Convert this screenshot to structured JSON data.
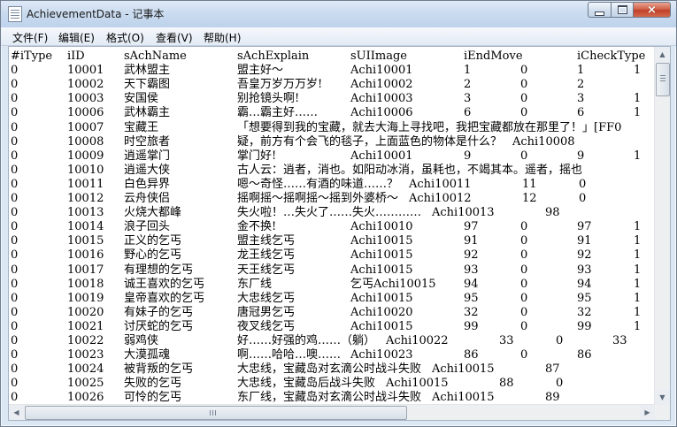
{
  "window": {
    "title": "AchievementData - 记事本",
    "buttons": {
      "minimize": "minimize",
      "maximize": "maximize",
      "close": "×"
    }
  },
  "menu": [
    "文件(F)",
    "编辑(E)",
    "格式(O)",
    "查看(V)",
    "帮助(H)"
  ],
  "header": [
    "#iType",
    "iID",
    "sAchName",
    "sAchExplain",
    "sUIImage",
    "iEndMove",
    "iCheckType"
  ],
  "rows": [
    {
      "type": "0",
      "id": "10001",
      "name": "武林盟主",
      "explain": "盟主好～",
      "image": "Achi10001",
      "c1": "1",
      "c2": "0",
      "c3": "1",
      "c4": "1"
    },
    {
      "type": "0",
      "id": "10002",
      "name": "天下霸图",
      "explain": "吾皇万岁万万岁!",
      "image": "Achi10002",
      "c1": "2",
      "c2": "0",
      "c3": "2",
      "c4": ""
    },
    {
      "type": "0",
      "id": "10003",
      "name": "安国侯",
      "explain": "别抢镜头啊!",
      "image": "Achi10003",
      "c1": "3",
      "c2": "0",
      "c3": "3",
      "c4": "1"
    },
    {
      "type": "0",
      "id": "10006",
      "name": "武林霸主",
      "explain": "霸…霸主好……",
      "image": "Achi10006",
      "c1": "6",
      "c2": "0",
      "c3": "6",
      "c4": "1"
    },
    {
      "type": "0",
      "id": "10007",
      "name": "宝藏王",
      "explain": "「想要得到我的宝藏，就去大海上寻找吧，我把宝藏都放在那里了！」[FF0",
      "image": "",
      "c1": "",
      "c2": "",
      "c3": "",
      "c4": ""
    },
    {
      "type": "0",
      "id": "10008",
      "name": "时空旅者",
      "explain": "疑，前方有个会飞的毯子，上面蓝色的物体是什么？",
      "image": "Achi10008",
      "c1": "",
      "c2": "",
      "c3": "",
      "c4": ""
    },
    {
      "type": "0",
      "id": "10009",
      "name": "逍遥掌门",
      "explain": "掌门好!",
      "image": "Achi10001",
      "c1": "9",
      "c2": "0",
      "c3": "9",
      "c4": "1"
    },
    {
      "type": "0",
      "id": "10010",
      "name": "逍遥大侠",
      "explain": "古人云：逍者，消也。如阳动冰消，虽耗也，不竭其本。遥者，摇也",
      "image": "",
      "c1": "",
      "c2": "",
      "c3": "",
      "c4": ""
    },
    {
      "type": "0",
      "id": "10011",
      "name": "白色异界",
      "explain": "嗯～奇怪……有酒的味道……？",
      "image": "Achi10011",
      "c1": "11",
      "c2": "0",
      "c3": "",
      "c4": ""
    },
    {
      "type": "0",
      "id": "10012",
      "name": "云舟侠侣",
      "explain": "摇啊摇～摇啊摇～摇到外婆桥～",
      "image": "Achi10012",
      "c1": "12",
      "c2": "0",
      "c3": "",
      "c4": ""
    },
    {
      "type": "0",
      "id": "10013",
      "name": "火烧大都峰",
      "explain": "失火啦！…失火了……失火…………",
      "image": "Achi10013",
      "c1": "98",
      "c2": "",
      "c3": "",
      "c4": ""
    },
    {
      "type": "0",
      "id": "10014",
      "name": "浪子回头",
      "explain": "金不换!",
      "image": "Achi10010",
      "c1": "97",
      "c2": "0",
      "c3": "97",
      "c4": "1"
    },
    {
      "type": "0",
      "id": "10015",
      "name": "正义的乞丐",
      "explain": "盟主线乞丐",
      "image": "Achi10015",
      "c1": "91",
      "c2": "0",
      "c3": "91",
      "c4": "1"
    },
    {
      "type": "0",
      "id": "10016",
      "name": "野心的乞丐",
      "explain": "龙王线乞丐",
      "image": "Achi10015",
      "c1": "92",
      "c2": "0",
      "c3": "92",
      "c4": "1"
    },
    {
      "type": "0",
      "id": "10017",
      "name": "有理想的乞丐",
      "explain": "天王线乞丐",
      "image": "Achi10015",
      "c1": "93",
      "c2": "0",
      "c3": "93",
      "c4": "1"
    },
    {
      "type": "0",
      "id": "10018",
      "name": "诚王喜欢的乞丐",
      "explain": "东厂线",
      "image": "乞丐Achi10015",
      "c1": "94",
      "c2": "0",
      "c3": "94",
      "c4": "1"
    },
    {
      "type": "0",
      "id": "10019",
      "name": "皇帝喜欢的乞丐",
      "explain": "大忠线乞丐",
      "image": "Achi10015",
      "c1": "95",
      "c2": "0",
      "c3": "95",
      "c4": "1"
    },
    {
      "type": "0",
      "id": "10020",
      "name": "有妹子的乞丐",
      "explain": "唐冠男乞丐",
      "image": "Achi10020",
      "c1": "32",
      "c2": "0",
      "c3": "32",
      "c4": "1"
    },
    {
      "type": "0",
      "id": "10021",
      "name": "讨厌蛇的乞丐",
      "explain": "夜叉线乞丐",
      "image": "Achi10015",
      "c1": "99",
      "c2": "0",
      "c3": "99",
      "c4": "1"
    },
    {
      "type": "0",
      "id": "10022",
      "name": "弱鸡侠",
      "explain": "好……好强的鸡……（躺）",
      "image": "Achi10022",
      "c1": "33",
      "c2": "0",
      "c3": "33",
      "c4": ""
    },
    {
      "type": "0",
      "id": "10023",
      "name": "大漠孤魂",
      "explain": "啊……哈哈…噢……",
      "image": "Achi10023",
      "c1": "86",
      "c2": "0",
      "c3": "86",
      "c4": ""
    },
    {
      "type": "0",
      "id": "10024",
      "name": "被背叛的乞丐",
      "explain": "大忠线，宝藏岛对玄滴公时战斗失败",
      "image": "Achi10015",
      "c1": "87",
      "c2": "",
      "c3": "",
      "c4": ""
    },
    {
      "type": "0",
      "id": "10025",
      "name": "失败的乞丐",
      "explain": "大忠线，宝藏岛后战斗失败",
      "image": "Achi10015",
      "c1": "88",
      "c2": "0",
      "c3": "",
      "c4": ""
    },
    {
      "type": "0",
      "id": "10026",
      "name": "可怜的乞丐",
      "explain": "东厂线，宝藏岛对玄滴公时战斗失败",
      "image": "Achi10015",
      "c1": "89",
      "c2": "",
      "c3": "",
      "c4": ""
    }
  ]
}
